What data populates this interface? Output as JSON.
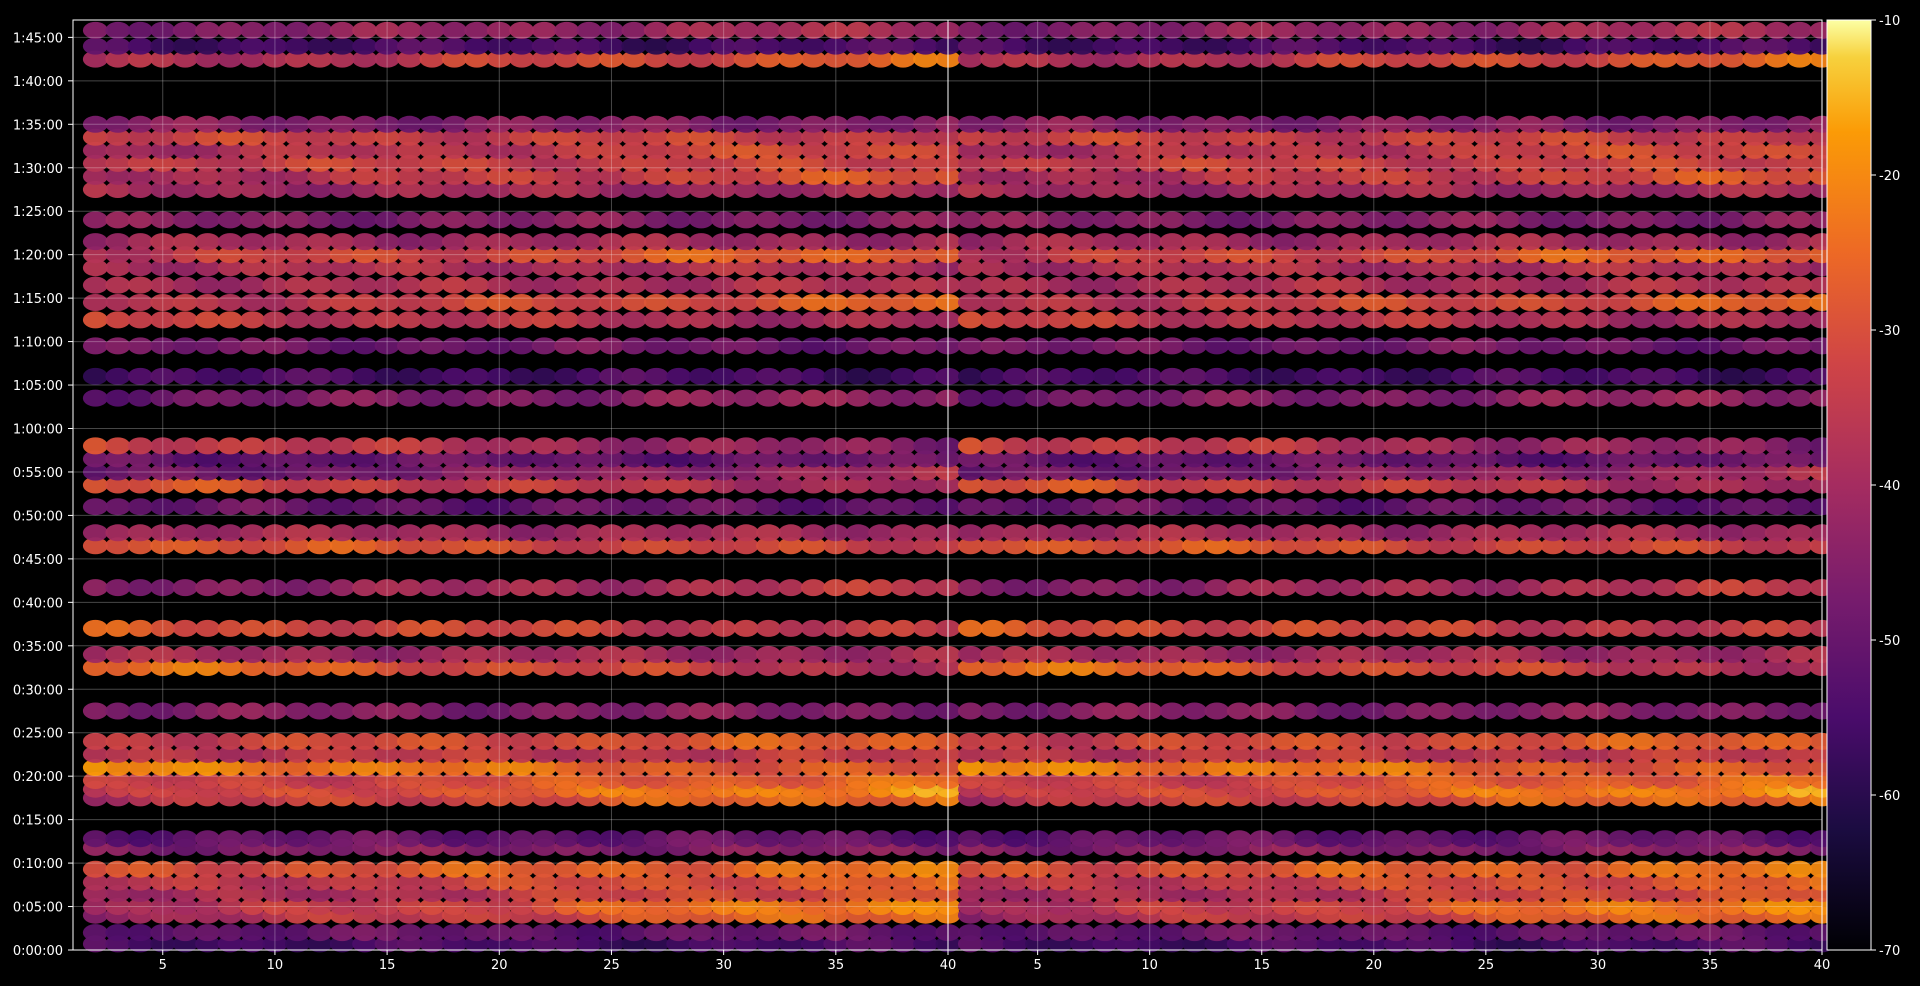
{
  "chart_data": {
    "type": "heatmap",
    "title": "",
    "xlabel": "",
    "ylabel": "",
    "grid": true,
    "colormap": "inferno",
    "background": "#000000",
    "panels": [
      {
        "name": "",
        "xlim": [
          1,
          40
        ],
        "xticks": [
          5,
          10,
          15,
          20,
          25,
          30,
          35,
          40
        ]
      },
      {
        "name": "",
        "xlim": [
          1,
          40
        ],
        "xticks": [
          5,
          10,
          15,
          20,
          25,
          30,
          35,
          40
        ]
      }
    ],
    "ylim_seconds": [
      0,
      6420
    ],
    "yticks": [
      "0:00:00",
      "0:05:00",
      "0:10:00",
      "0:15:00",
      "0:20:00",
      "0:25:00",
      "0:30:00",
      "0:35:00",
      "0:40:00",
      "0:45:00",
      "0:50:00",
      "0:55:00",
      "1:00:00",
      "1:05:00",
      "1:10:00",
      "1:15:00",
      "1:20:00",
      "1:25:00",
      "1:30:00",
      "1:35:00",
      "1:40:00",
      "1:45:00"
    ],
    "xtick_labels": [
      "5",
      "10",
      "15",
      "20",
      "25",
      "30",
      "35",
      "40"
    ],
    "colorbar": {
      "range": [
        -70,
        -10
      ],
      "ticks": [
        -10,
        -20,
        -30,
        -40,
        -50,
        -60,
        -70
      ]
    },
    "x_channels": [
      2,
      40
    ],
    "bands": [
      {
        "t": 0.7,
        "level": -55,
        "x_mod": 0
      },
      {
        "t": 2.0,
        "level": -50,
        "x_mod": 0
      },
      {
        "t": 4.0,
        "level": -32,
        "x_mod": 10
      },
      {
        "t": 5.0,
        "level": -30,
        "x_mod": 12
      },
      {
        "t": 6.5,
        "level": -35,
        "x_mod": 8
      },
      {
        "t": 7.8,
        "level": -32,
        "x_mod": 6
      },
      {
        "t": 9.3,
        "level": -27,
        "x_mod": 4
      },
      {
        "t": 11.8,
        "level": -45,
        "x_mod": 0
      },
      {
        "t": 12.8,
        "level": -50,
        "x_mod": 0
      },
      {
        "t": 17.5,
        "level": -30,
        "x_mod": 8
      },
      {
        "t": 18.5,
        "level": -27,
        "x_mod": 10
      },
      {
        "t": 19.5,
        "level": -30,
        "x_mod": 6
      },
      {
        "t": 21.0,
        "level": -24,
        "x_mod": -6
      },
      {
        "t": 22.5,
        "level": -35,
        "x_mod": 0
      },
      {
        "t": 24.0,
        "level": -30,
        "x_mod": 4
      },
      {
        "t": 27.5,
        "level": -45,
        "x_mod": 0
      },
      {
        "t": 32.5,
        "level": -30,
        "x_mod": -8
      },
      {
        "t": 34.0,
        "level": -40,
        "x_mod": 0
      },
      {
        "t": 37.0,
        "level": -32,
        "x_mod": -4
      },
      {
        "t": 41.7,
        "level": -40,
        "x_mod": 6
      },
      {
        "t": 46.5,
        "level": -30,
        "x_mod": -4
      },
      {
        "t": 48.0,
        "level": -40,
        "x_mod": 0
      },
      {
        "t": 51.0,
        "level": -50,
        "x_mod": 0
      },
      {
        "t": 53.5,
        "level": -34,
        "x_mod": -6
      },
      {
        "t": 55.0,
        "level": -45,
        "x_mod": 6
      },
      {
        "t": 56.5,
        "level": -50,
        "x_mod": 0
      },
      {
        "t": 58.0,
        "level": -38,
        "x_mod": -8
      },
      {
        "t": 63.5,
        "level": -45,
        "x_mod": 4
      },
      {
        "t": 66.0,
        "level": -55,
        "x_mod": 0
      },
      {
        "t": 69.5,
        "level": -48,
        "x_mod": 0
      },
      {
        "t": 72.5,
        "level": -36,
        "x_mod": -4
      },
      {
        "t": 74.5,
        "level": -32,
        "x_mod": 6
      },
      {
        "t": 76.5,
        "level": -38,
        "x_mod": 0
      },
      {
        "t": 78.5,
        "level": -38,
        "x_mod": 0
      },
      {
        "t": 80.0,
        "level": -30,
        "x_mod": 6
      },
      {
        "t": 81.5,
        "level": -40,
        "x_mod": 0
      },
      {
        "t": 84.0,
        "level": -45,
        "x_mod": 0
      },
      {
        "t": 87.5,
        "level": -40,
        "x_mod": 0
      },
      {
        "t": 89.0,
        "level": -34,
        "x_mod": 6
      },
      {
        "t": 90.5,
        "level": -33,
        "x_mod": 0
      },
      {
        "t": 92.0,
        "level": -35,
        "x_mod": 6
      },
      {
        "t": 93.5,
        "level": -33,
        "x_mod": 0
      },
      {
        "t": 95.0,
        "level": -45,
        "x_mod": 0
      },
      {
        "t": 102.5,
        "level": -33,
        "x_mod": 8
      },
      {
        "t": 104.0,
        "level": -55,
        "x_mod": 0
      },
      {
        "t": 105.8,
        "level": -42,
        "x_mod": 4
      }
    ]
  }
}
